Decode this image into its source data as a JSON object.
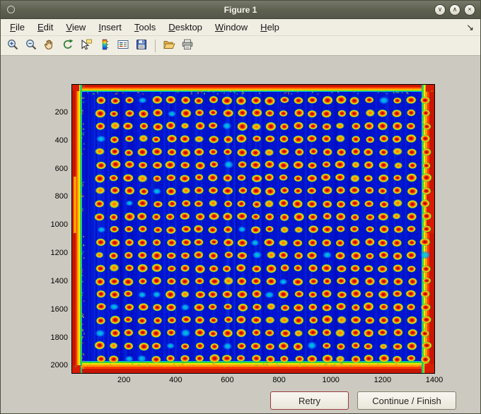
{
  "window": {
    "title": "Figure 1",
    "controls": [
      {
        "name": "minimize-button",
        "glyph": "∨"
      },
      {
        "name": "maximize-button",
        "glyph": "∧"
      },
      {
        "name": "close-button",
        "glyph": "×"
      }
    ]
  },
  "menubar": {
    "items": [
      "File",
      "Edit",
      "View",
      "Insert",
      "Tools",
      "Desktop",
      "Window",
      "Help"
    ],
    "dock_arrow_glyph": "↘"
  },
  "toolbar": {
    "buttons": [
      {
        "name": "zoom-in"
      },
      {
        "name": "zoom-out"
      },
      {
        "name": "pan"
      },
      {
        "name": "rotate-3d"
      },
      {
        "name": "data-cursor"
      },
      {
        "name": "insert-colorbar"
      },
      {
        "name": "insert-legend"
      },
      {
        "name": "save-figure"
      },
      {
        "type": "separator"
      },
      {
        "name": "open-file"
      },
      {
        "name": "print-figure"
      }
    ]
  },
  "buttons": {
    "retry": "Retry",
    "continue": "Continue / Finish"
  },
  "chart_data": {
    "type": "heatmap",
    "title": "",
    "xlabel": "",
    "ylabel": "",
    "x_ticks": [
      200,
      400,
      600,
      800,
      1000,
      1200,
      1400
    ],
    "y_ticks": [
      200,
      400,
      600,
      800,
      1000,
      1200,
      1400,
      1600,
      1800,
      2000
    ],
    "x_range": [
      0,
      1400
    ],
    "y_range": [
      0,
      2048
    ],
    "colormap": "jet",
    "description": "Microarray scan shown with jet colormap: deep blue background, regular grid of red/orange spots with yellow-green halos, saturated red-orange-yellow bands along all four image edges",
    "spot_grid": {
      "rows": 21,
      "cols": 24
    },
    "colors": {
      "background_low": "#0013cf",
      "spot_core": "#8e0000",
      "spot_mid": "#ff7c00",
      "spot_halo": "#ffe400",
      "edge_high": "#c81600"
    }
  },
  "colors": {
    "titlebar": "#5e604f",
    "chrome_bg": "#f0ede3",
    "figure_bg": "#cccac0",
    "retry_border": "#9a3a3a"
  }
}
